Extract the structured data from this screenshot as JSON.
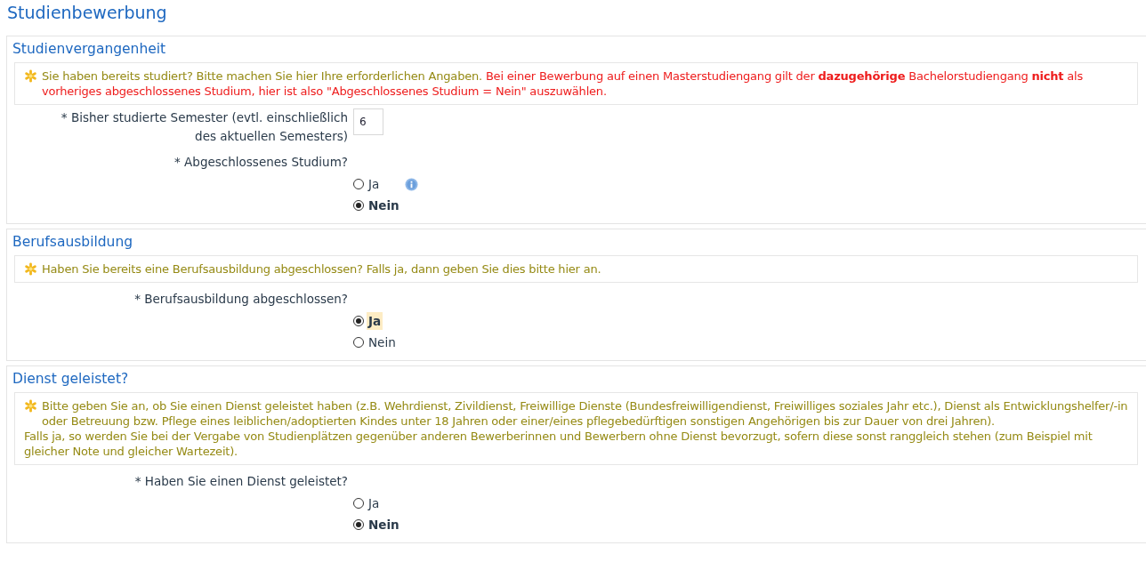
{
  "page_title": "Studienbewerbung",
  "sections": [
    {
      "title": "Studienvergangenheit",
      "info": {
        "lines": [
          [
            {
              "kind": "normal",
              "text": "Sie haben bereits studiert? Bitte machen Sie hier Ihre erforderlichen Angaben."
            },
            {
              "kind": "warning",
              "text": "Bei einer Bewerbung auf einen Masterstudiengang gilt der **dazugehörige** Bachelorstudiengang **nicht** als vorheriges abgeschlossenes Studium, hier ist also \"Abgeschlossenes Studium = Nein\" auszuwählen."
            }
          ]
        ]
      },
      "fields": [
        {
          "kind": "number",
          "label": "* Bisher studierte Semester (evtl. einschließlich des aktuellen Semesters)",
          "value": "6"
        },
        {
          "kind": "radio",
          "label": "* Abgeschlossenes Studium?",
          "options": [
            {
              "label": "Ja",
              "selected": false,
              "focused": false,
              "info_icon": true
            },
            {
              "label": "Nein",
              "selected": true,
              "focused": false,
              "info_icon": false
            }
          ]
        }
      ]
    },
    {
      "title": "Berufsausbildung",
      "info": {
        "lines": [
          [
            {
              "kind": "normal",
              "text": "Haben Sie bereits eine Berufsausbildung abgeschlossen? Falls ja, dann geben Sie dies bitte hier an."
            }
          ]
        ]
      },
      "fields": [
        {
          "kind": "radio",
          "label": "* Berufsausbildung abgeschlossen?",
          "options": [
            {
              "label": "Ja",
              "selected": true,
              "focused": true
            },
            {
              "label": "Nein",
              "selected": false,
              "focused": false
            }
          ]
        }
      ]
    },
    {
      "title": "Dienst geleistet?",
      "info": {
        "lines": [
          [
            {
              "kind": "normal",
              "text": "Bitte geben Sie an, ob Sie einen Dienst geleistet haben (z.B. Wehrdienst, Zivildienst, Freiwillige Dienste (Bundesfreiwilligendienst, Freiwilliges soziales Jahr etc.), Dienst als Entwicklungshelfer/-in oder Betreuung bzw. Pflege eines leiblichen/adoptierten Kindes unter 18 Jahren oder einer/eines pflegebedürftigen sonstigen Angehörigen bis zur Dauer von drei Jahren)."
            }
          ],
          [
            {
              "kind": "normal",
              "text": "Falls ja, so werden Sie bei der Vergabe von Studienplätzen gegenüber anderen Bewerberinnen und Bewerbern ohne Dienst bevorzugt, sofern diese sonst ranggleich stehen (zum Beispiel mit gleicher Note und gleicher Wartezeit)."
            }
          ]
        ]
      },
      "fields": [
        {
          "kind": "radio",
          "label": "* Haben Sie einen Dienst geleistet?",
          "options": [
            {
              "label": "Ja",
              "selected": false,
              "focused": false
            },
            {
              "label": "Nein",
              "selected": true,
              "focused": false
            }
          ]
        }
      ]
    }
  ]
}
